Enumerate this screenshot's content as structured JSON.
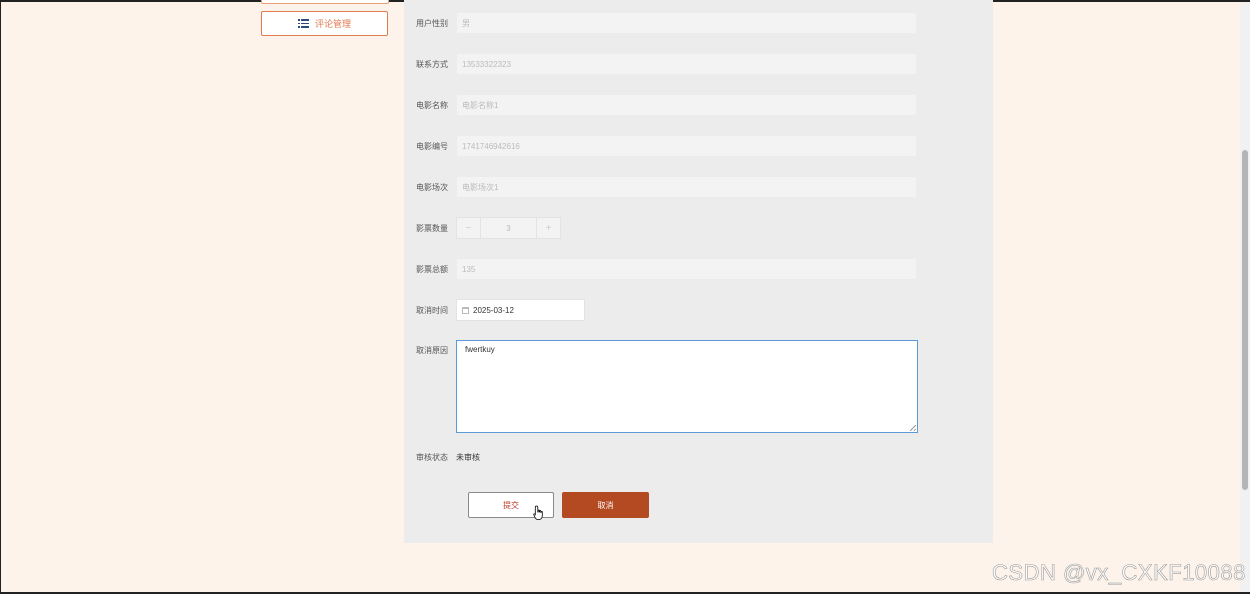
{
  "sidebar": {
    "item_label": "评论管理",
    "item_icon": "list-icon"
  },
  "form": {
    "gender": {
      "label": "用户性别",
      "value": "男"
    },
    "phone": {
      "label": "联系方式",
      "value": "13533322323"
    },
    "movie_name": {
      "label": "电影名称",
      "value": "电影名称1"
    },
    "movie_code": {
      "label": "电影编号",
      "value": "1741746942616"
    },
    "movie_session": {
      "label": "电影场次",
      "value": "电影场次1"
    },
    "ticket_count": {
      "label": "影票数量",
      "value": "3",
      "minus": "−",
      "plus": "+"
    },
    "ticket_total": {
      "label": "影票总额",
      "value": "135"
    },
    "cancel_time": {
      "label": "取消时间",
      "value": "2025-03-12"
    },
    "cancel_reason": {
      "label": "取消原因",
      "value": "fwertkuy"
    },
    "review_status": {
      "label": "审核状态",
      "value": "未审核"
    }
  },
  "actions": {
    "submit_label": "提交",
    "cancel_label": "取消"
  },
  "watermark": "CSDN @vx_CXKF10088",
  "colors": {
    "page_bg": "#fdf3ea",
    "accent": "#e07a4f",
    "primary_button": "#b34a22",
    "panel_bg": "#ececec",
    "focus_border": "#5b9ad8"
  }
}
